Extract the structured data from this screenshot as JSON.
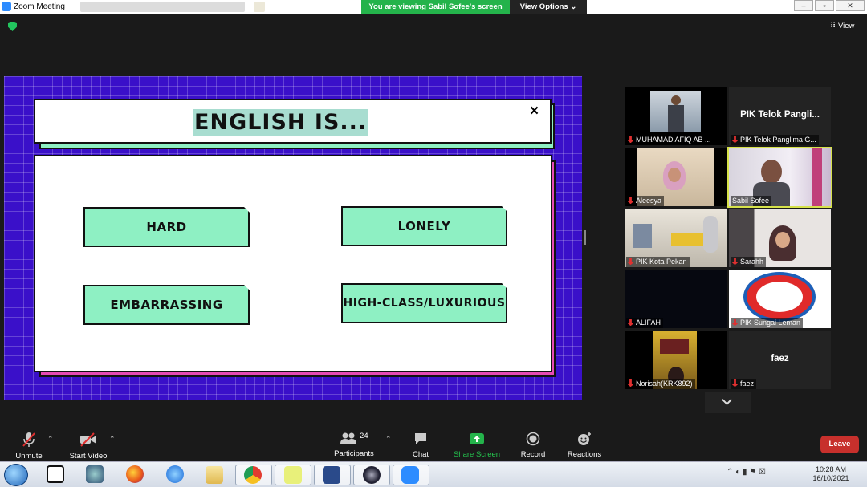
{
  "window": {
    "title": "Zoom Meeting",
    "share_banner": "You are viewing Sabil Sofee's screen",
    "view_options": "View Options ⌄",
    "view_button": "View"
  },
  "slide": {
    "title": "ENGLISH IS...",
    "close_glyph": "×",
    "options": [
      "HARD",
      "LONELY",
      "EMBARRASSING",
      "HIGH-CLASS/LUXURIOUS"
    ],
    "colors": {
      "background": "#3a10c9",
      "option_fill": "#8ef0c3",
      "accent_pink": "#e64ab5",
      "title_highlight": "#a8ddd0"
    }
  },
  "participants": [
    {
      "name": "MUHAMAD AFIQ AB ...",
      "big_name": ""
    },
    {
      "name": "PIK Telok Panglima G...",
      "big_name": "PIK Telok Pangli..."
    },
    {
      "name": "Aleesya",
      "big_name": ""
    },
    {
      "name": "Sabil Sofee",
      "big_name": ""
    },
    {
      "name": "PIK Kota Pekan",
      "big_name": ""
    },
    {
      "name": "Sarahh",
      "big_name": ""
    },
    {
      "name": "ALIFAH",
      "big_name": ""
    },
    {
      "name": "PIK Sungai Leman",
      "big_name": ""
    },
    {
      "name": "Norisah(KRK892)",
      "big_name": ""
    },
    {
      "name": "faez",
      "big_name": "faez"
    }
  ],
  "toolbar": {
    "unmute": "Unmute",
    "start_video": "Start Video",
    "participants": "Participants",
    "participants_count": "24",
    "chat": "Chat",
    "share_screen": "Share Screen",
    "record": "Record",
    "reactions": "Reactions",
    "leave": "Leave"
  },
  "taskbar": {
    "time": "10:28 AM",
    "date": "16/10/2021"
  }
}
